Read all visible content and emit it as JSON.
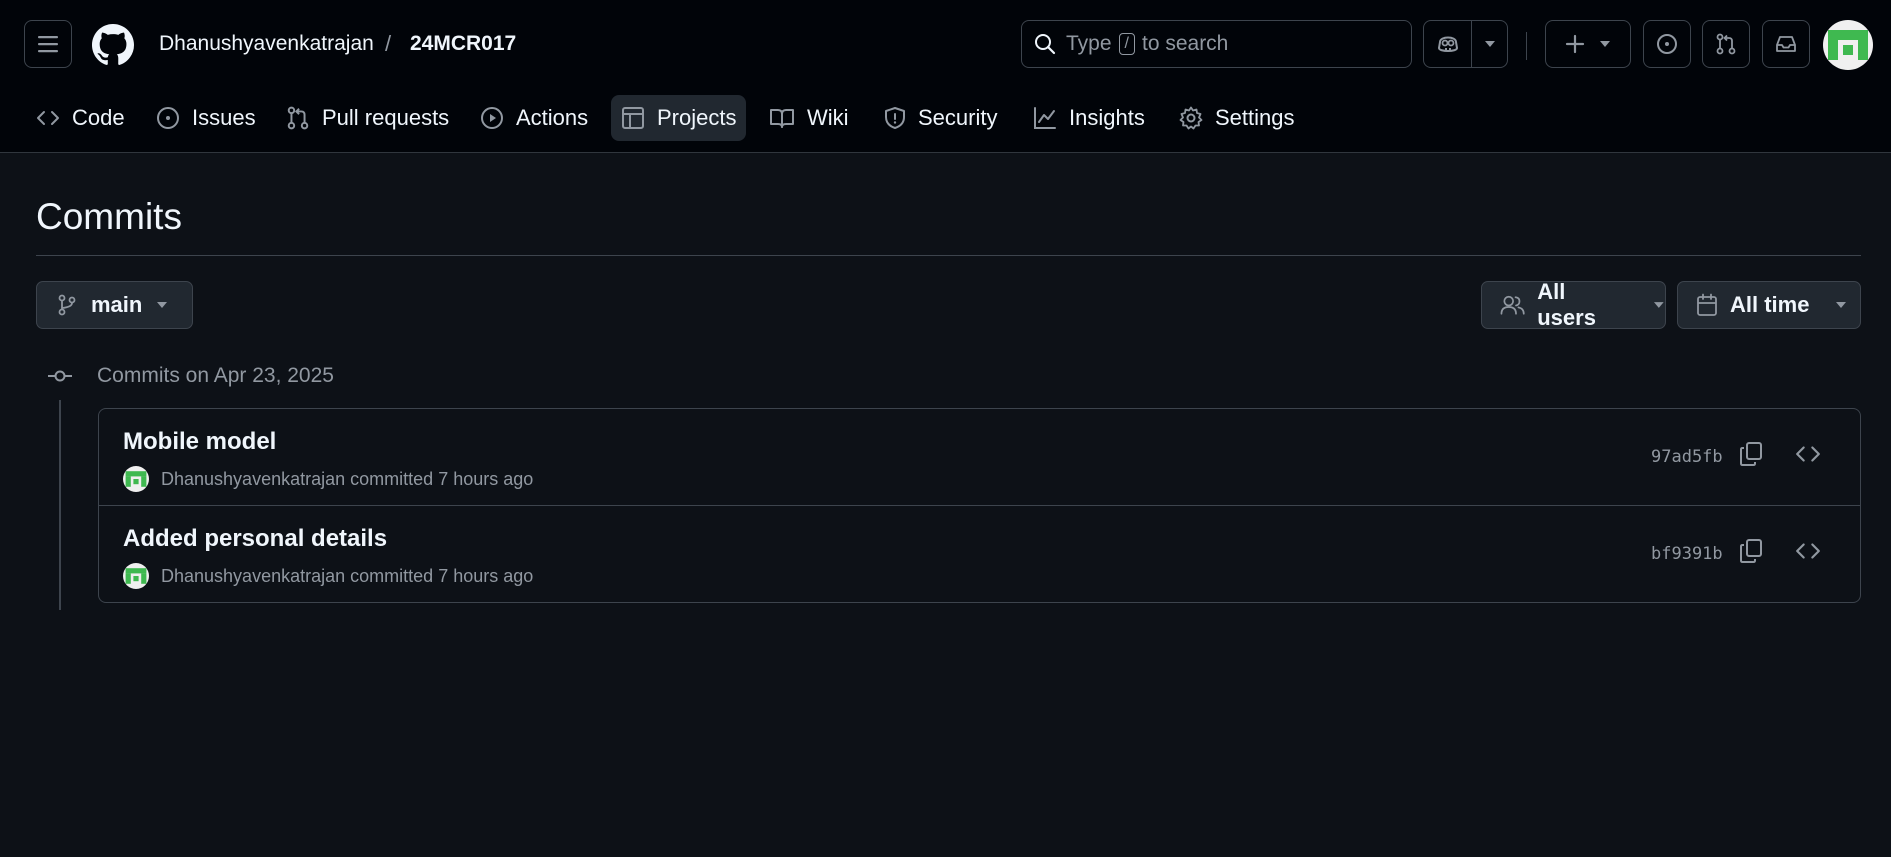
{
  "header": {
    "owner": "Dhanushyavenkatrajan",
    "separator": "/",
    "repo": "24MCR017",
    "search": {
      "prefix": "Type",
      "key": "/",
      "suffix": "to search"
    }
  },
  "nav": {
    "tabs": [
      {
        "label": "Code",
        "icon": "code-icon"
      },
      {
        "label": "Issues",
        "icon": "issue-icon"
      },
      {
        "label": "Pull requests",
        "icon": "pull-request-icon"
      },
      {
        "label": "Actions",
        "icon": "play-icon"
      },
      {
        "label": "Projects",
        "icon": "table-icon",
        "active": true
      },
      {
        "label": "Wiki",
        "icon": "book-icon"
      },
      {
        "label": "Security",
        "icon": "shield-icon"
      },
      {
        "label": "Insights",
        "icon": "graph-icon"
      },
      {
        "label": "Settings",
        "icon": "gear-icon"
      }
    ]
  },
  "page": {
    "title": "Commits",
    "branch": "main",
    "users_filter": "All users",
    "time_filter": "All time"
  },
  "commit_groups": [
    {
      "heading": "Commits on Apr 23, 2025",
      "commits": [
        {
          "title": "Mobile model",
          "author": "Dhanushyavenkatrajan",
          "verb": "committed",
          "time": "7 hours ago",
          "sha": "97ad5fb"
        },
        {
          "title": "Added personal details",
          "author": "Dhanushyavenkatrajan",
          "verb": "committed",
          "time": "7 hours ago",
          "sha": "bf9391b"
        }
      ]
    }
  ],
  "colors": {
    "background": "#0d1117",
    "header": "#010409",
    "border": "#3d444d",
    "text": "#f0f6fc",
    "muted": "#9198a1",
    "avatar_green": "#3fb950"
  }
}
